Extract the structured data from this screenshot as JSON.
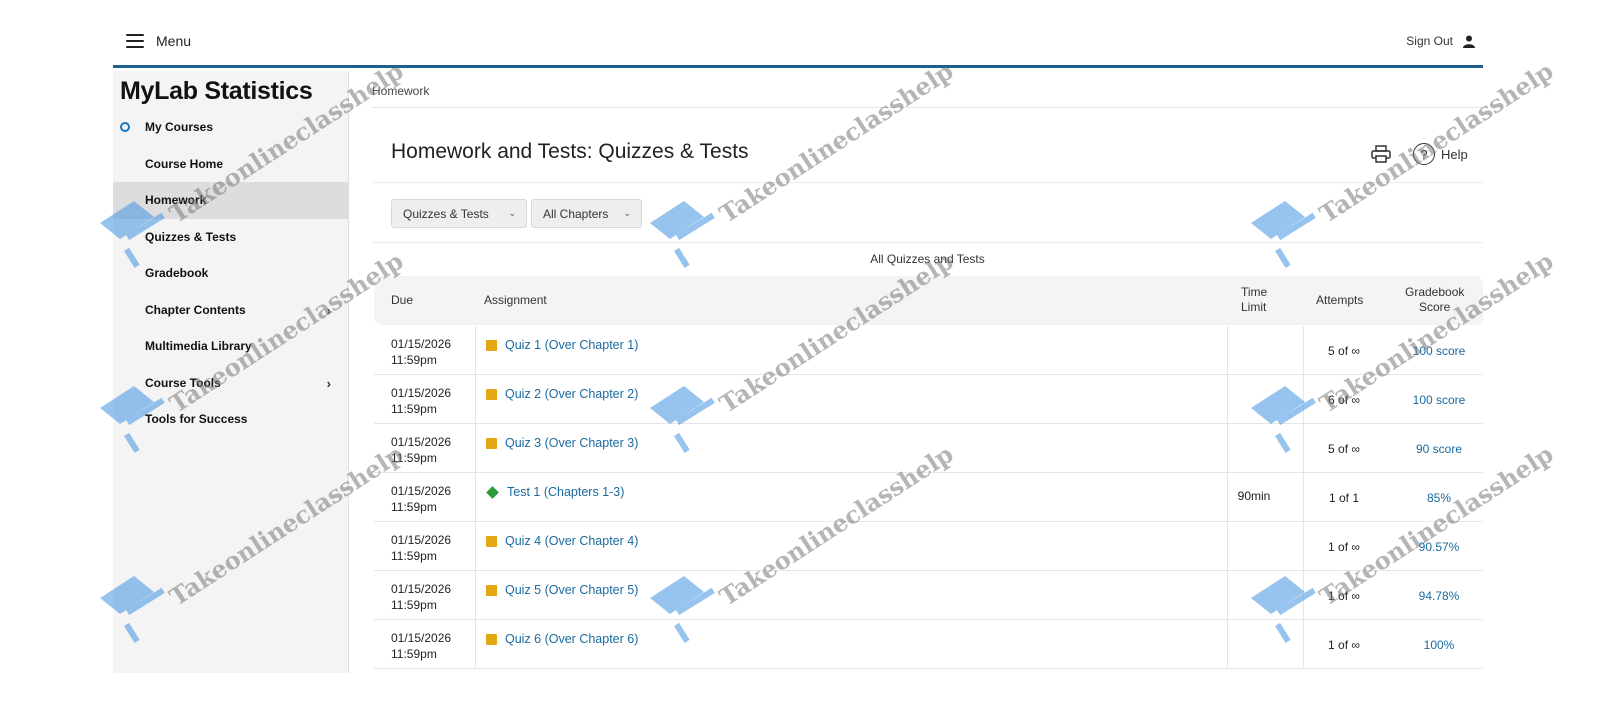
{
  "header": {
    "menu_label": "Menu",
    "signout_label": "Sign Out"
  },
  "sidebar": {
    "brand": "MyLab Statistics",
    "items": [
      {
        "label": "My Courses"
      },
      {
        "label": "Course Home"
      },
      {
        "label": "Homework"
      },
      {
        "label": "Quizzes & Tests"
      },
      {
        "label": "Gradebook"
      },
      {
        "label": "Chapter Contents"
      },
      {
        "label": "Multimedia Library"
      },
      {
        "label": "Course Tools"
      },
      {
        "label": "Tools for Success"
      }
    ]
  },
  "breadcrumb": "Homework",
  "main": {
    "title": "Homework and Tests: Quizzes & Tests",
    "help_label": "Help",
    "filters": {
      "type": "Quizzes & Tests",
      "chapter": "All Chapters"
    },
    "caption": "All Quizzes and Tests",
    "columns": {
      "due": "Due",
      "assignment": "Assignment",
      "time_limit_1": "Time",
      "time_limit_2": "Limit",
      "attempts": "Attempts",
      "score_1": "Gradebook",
      "score_2": "Score"
    },
    "rows": [
      {
        "date": "01/15/2026",
        "time": "11:59pm",
        "name": "Quiz 1 (Over Chapter 1)",
        "kind": "quiz",
        "limit": "",
        "attempts": "5 of ∞",
        "score": "100 score"
      },
      {
        "date": "01/15/2026",
        "time": "11:59pm",
        "name": "Quiz 2 (Over Chapter 2)",
        "kind": "quiz",
        "limit": "",
        "attempts": "6 of ∞",
        "score": "100 score"
      },
      {
        "date": "01/15/2026",
        "time": "11:59pm",
        "name": "Quiz 3 (Over Chapter 3)",
        "kind": "quiz",
        "limit": "",
        "attempts": "5 of ∞",
        "score": "90 score"
      },
      {
        "date": "01/15/2026",
        "time": "11:59pm",
        "name": "Test 1 (Chapters 1-3)",
        "kind": "test",
        "limit": "90min",
        "attempts": "1 of 1",
        "score": "85%"
      },
      {
        "date": "01/15/2026",
        "time": "11:59pm",
        "name": "Quiz 4 (Over Chapter 4)",
        "kind": "quiz",
        "limit": "",
        "attempts": "1 of ∞",
        "score": "90.57%"
      },
      {
        "date": "01/15/2026",
        "time": "11:59pm",
        "name": "Quiz 5 (Over Chapter 5)",
        "kind": "quiz",
        "limit": "",
        "attempts": "1 of ∞",
        "score": "94.78%"
      },
      {
        "date": "01/15/2026",
        "time": "11:59pm",
        "name": "Quiz 6 (Over Chapter 6)",
        "kind": "quiz",
        "limit": "",
        "attempts": "1 of ∞",
        "score": "100%"
      }
    ]
  },
  "watermark": "Takeonlineclasshelp",
  "colors": {
    "accent": "#1f5f8b",
    "link": "#1a6a9e",
    "quiz": "#e3a712",
    "test": "#2e9a3a"
  }
}
